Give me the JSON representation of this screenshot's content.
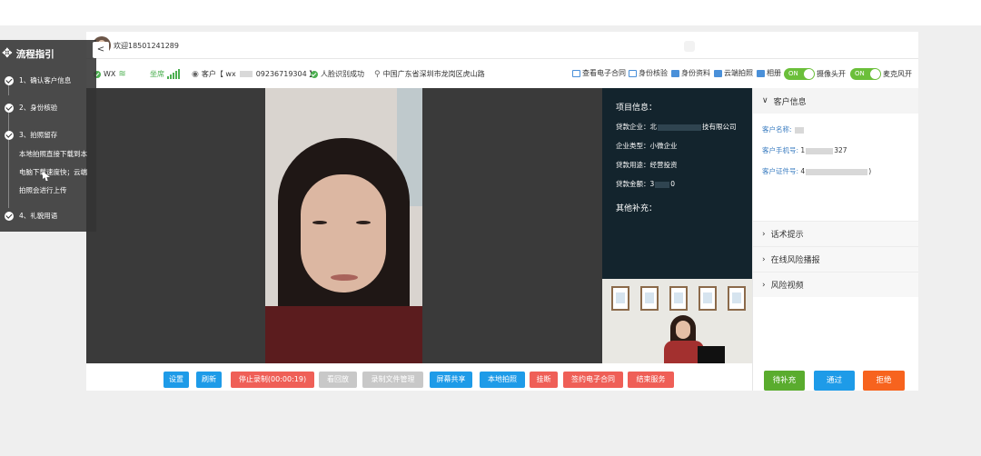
{
  "header": {
    "welcome": "欢迎18501241289"
  },
  "status": {
    "wx_label": "WX",
    "signal_label": "坐席",
    "customer": "客户【 wx",
    "customer_tail": "09236719304 】",
    "face_status": "人脸识别成功",
    "location": "中国广东省深圳市龙岗区虎山路"
  },
  "tools": {
    "contract": "查看电子合同",
    "identity": "身份核验",
    "materials": "身份资料",
    "cloud_photo": "云端拍照",
    "album": "相册",
    "camera_label": "摄像头开",
    "mic_label": "麦克风开",
    "toggle_on": "ON"
  },
  "project_info": {
    "title": "项目信息：",
    "company_prefix": "贷款企业：北",
    "company_suffix": "技有限公司",
    "type": "企业类型：小微企业",
    "usage": "贷款用途：经营投资",
    "amount_prefix": "贷款金额：3",
    "amount_suffix": "0",
    "extra_title": "其他补充："
  },
  "customer_panel": {
    "title": "客户信息",
    "name_label": "客户名称:",
    "phone_label": "客户手机号:",
    "phone_prefix": "1",
    "phone_suffix": "327",
    "id_label": "客户证件号:",
    "id_prefix": "4",
    "id_suffix": ")",
    "sections": [
      "话术提示",
      "在线风险播报",
      "风险视频"
    ]
  },
  "toolbar": {
    "settings": "设置",
    "refresh": "刷新",
    "stop_record": "停止录制(00:00:19)",
    "playback": "看回放",
    "record_files": "录制文件管理",
    "screen_share": "屏幕共享",
    "local_photo": "本地拍照",
    "hangup": "挂断",
    "sign_contract": "签约电子合同",
    "end_service": "结束服务"
  },
  "actions": {
    "pending": "待补充",
    "pass": "通过",
    "reject": "拒绝"
  },
  "guide": {
    "title": "流程指引",
    "close": "<",
    "step1": "1、确认客户信息",
    "step2": "2、身份核验",
    "step3": "3、拍照留存",
    "note1": "本地拍照直接下载到本",
    "note2": "电脑下载速度快；云端",
    "note3": "拍照会进行上传",
    "step4": "4、礼貌用语"
  }
}
